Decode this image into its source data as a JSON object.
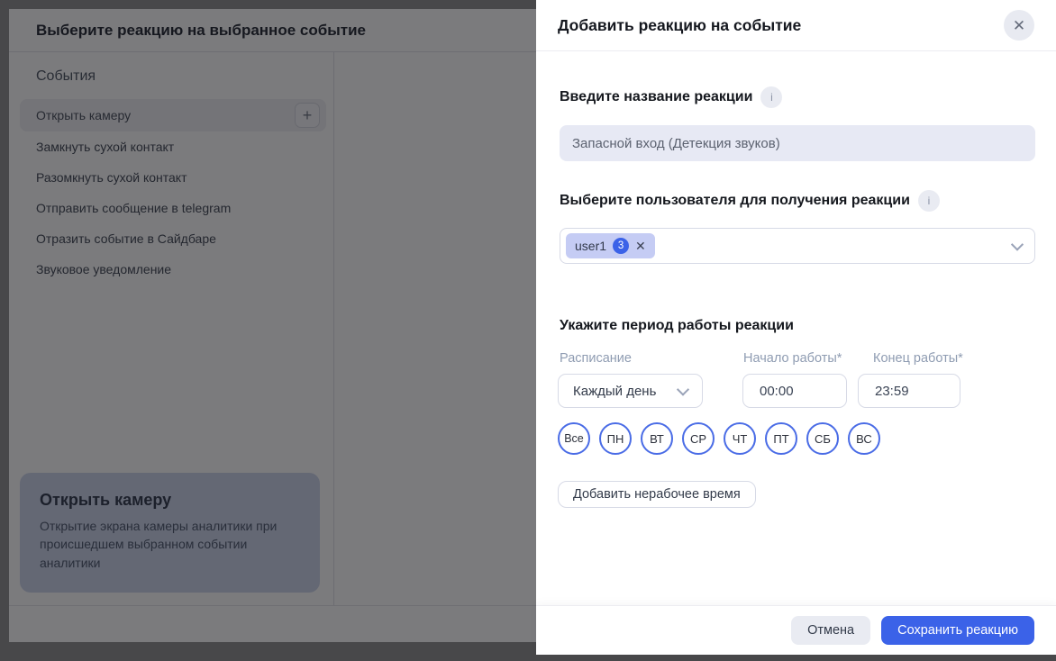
{
  "background": {
    "title": "Выберите реакцию на выбранное событие",
    "sidebar": {
      "heading": "События",
      "selected_item": {
        "label": "Открыть камеру",
        "add_icon": "+"
      },
      "items": [
        "Замкнуть сухой контакт",
        "Разомкнуть сухой контакт",
        "Отправить сообщение в telegram",
        "Отразить событие в Сайдбаре",
        "Звуковое уведомление"
      ]
    },
    "info_card": {
      "title": "Открыть камеру",
      "description": "Открытие экрана камеры аналитики при происшедшем выбранном событии аналитики"
    }
  },
  "modal": {
    "title": "Добавить реакцию на событие",
    "close_icon": "✕",
    "name_section": {
      "label": "Введите название реакции",
      "info_icon": "i",
      "value": "Запасной вход (Детекция звуков)"
    },
    "user_section": {
      "label": "Выберите пользователя для получения реакции",
      "info_icon": "i",
      "tag": {
        "name": "user1",
        "count": "3",
        "remove_icon": "✕"
      }
    },
    "period_section": {
      "heading": "Укажите период работы реакции",
      "schedule": {
        "label": "Расписание",
        "value": "Каждый день"
      },
      "start": {
        "label": "Начало работы",
        "required_mark": "*",
        "value": "00:00"
      },
      "end": {
        "label": "Конец работы",
        "required_mark": "*",
        "value": "23:59"
      },
      "days": [
        "Все",
        "ПН",
        "ВТ",
        "СР",
        "ЧТ",
        "ПТ",
        "СБ",
        "ВС"
      ],
      "add_downtime_button": "Добавить нерабочее время"
    },
    "footer": {
      "cancel": "Отмена",
      "save": "Сохранить реакцию"
    }
  },
  "colors": {
    "accent": "#3b62e8",
    "day_circle_border": "#4a6ce6",
    "tag_background": "#c5ccf4",
    "input_background": "#e7e9f4"
  }
}
